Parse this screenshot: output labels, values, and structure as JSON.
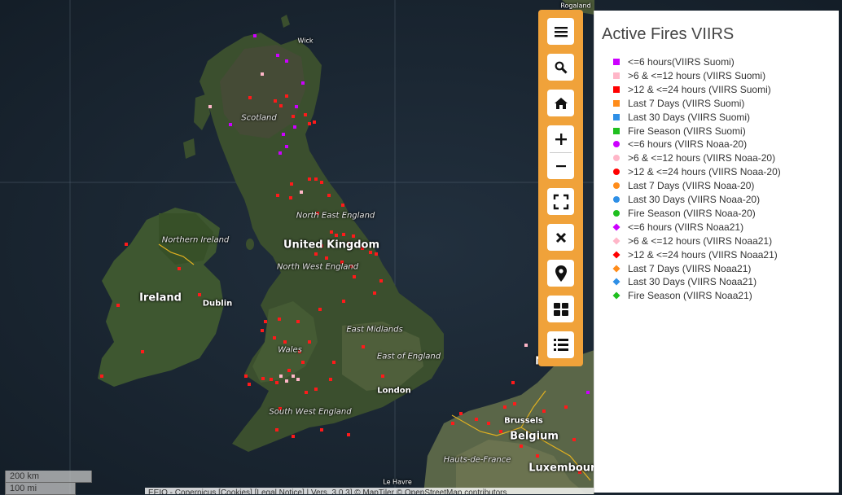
{
  "legend": {
    "title": "Active Fires VIIRS",
    "items": [
      {
        "label": "<=6 hours(VIIRS Suomi)",
        "color": "#cc00ff",
        "shape": "square"
      },
      {
        "label": ">6 & <=12 hours (VIIRS Suomi)",
        "color": "#ffb6c8",
        "shape": "square"
      },
      {
        "label": ">12 & <=24 hours (VIIRS Suomi)",
        "color": "#ff0000",
        "shape": "square"
      },
      {
        "label": "Last 7 Days (VIIRS Suomi)",
        "color": "#ff8c1a",
        "shape": "square"
      },
      {
        "label": "Last 30 Days (VIIRS Suomi)",
        "color": "#2e8fe6",
        "shape": "square"
      },
      {
        "label": "Fire Season (VIIRS Suomi)",
        "color": "#1fbf1f",
        "shape": "square"
      },
      {
        "label": "<=6 hours (VIIRS Noaa-20)",
        "color": "#cc00ff",
        "shape": "circle"
      },
      {
        "label": ">6 & <=12 hours (VIIRS Noaa-20)",
        "color": "#ffb6c8",
        "shape": "circle"
      },
      {
        "label": ">12 & <=24 hours (VIIRS Noaa-20)",
        "color": "#ff0000",
        "shape": "circle"
      },
      {
        "label": "Last 7 Days (VIIRS Noaa-20)",
        "color": "#ff8c1a",
        "shape": "circle"
      },
      {
        "label": "Last 30 Days (VIIRS Noaa-20)",
        "color": "#2e8fe6",
        "shape": "circle"
      },
      {
        "label": "Fire Season (VIIRS Noaa-20)",
        "color": "#1fbf1f",
        "shape": "circle"
      },
      {
        "label": "<=6 hours (VIIRS Noaa21)",
        "color": "#cc00ff",
        "shape": "diamond"
      },
      {
        "label": ">6 & <=12 hours (VIIRS Noaa21)",
        "color": "#ffb6c8",
        "shape": "diamond"
      },
      {
        "label": ">12 & <=24 hours (VIIRS Noaa21)",
        "color": "#ff0000",
        "shape": "diamond"
      },
      {
        "label": "Last 7 Days (VIIRS Noaa21)",
        "color": "#ff8c1a",
        "shape": "diamond"
      },
      {
        "label": "Last 30 Days (VIIRS Noaa21)",
        "color": "#2e8fe6",
        "shape": "diamond"
      },
      {
        "label": "Fire Season (VIIRS Noaa21)",
        "color": "#1fbf1f",
        "shape": "diamond"
      }
    ]
  },
  "toolbar": {
    "buttons": [
      {
        "name": "menu-button",
        "icon": "menu-icon"
      },
      {
        "name": "search-button",
        "icon": "search-icon"
      },
      {
        "name": "home-button",
        "icon": "home-icon"
      },
      {
        "name": "zoom-in-button",
        "icon": "plus-icon"
      },
      {
        "name": "zoom-out-button",
        "icon": "minus-icon"
      },
      {
        "name": "fullscreen-button",
        "icon": "fullscreen-icon"
      },
      {
        "name": "close-button",
        "icon": "close-icon"
      },
      {
        "name": "location-button",
        "icon": "map-marker-icon"
      },
      {
        "name": "basemap-button",
        "icon": "grid-icon"
      },
      {
        "name": "layer-list-button",
        "icon": "list-icon"
      }
    ]
  },
  "map": {
    "places": {
      "ragaland": "Rogaland",
      "wick": "Wick",
      "scotland": "Scotland",
      "north_east_england": "North East England",
      "northern_ireland": "Northern Ireland",
      "united_kingdom": "United Kingdom",
      "north_west_england": "North West England",
      "ireland": "Ireland",
      "dublin": "Dublin",
      "east_midlands": "East Midlands",
      "wales": "Wales",
      "east_of_england": "East of England",
      "london": "London",
      "south_west_england": "South West England",
      "netherlands": "Ne",
      "brussels": "Brussels",
      "belgium": "Belgium",
      "hauts_de_france": "Hauts-de-France",
      "luxembourg": "Luxembourg",
      "le_havre": "Le Havre"
    },
    "fire_color": "#ff1a1a"
  },
  "scale": {
    "km": "200 km",
    "mi": "100 mi"
  },
  "attribution": "EEIO - Copernicus [Cookies] [Legal Notice] | Vers. 3.0.3] © MapTiler © OpenStreetMap contributors"
}
